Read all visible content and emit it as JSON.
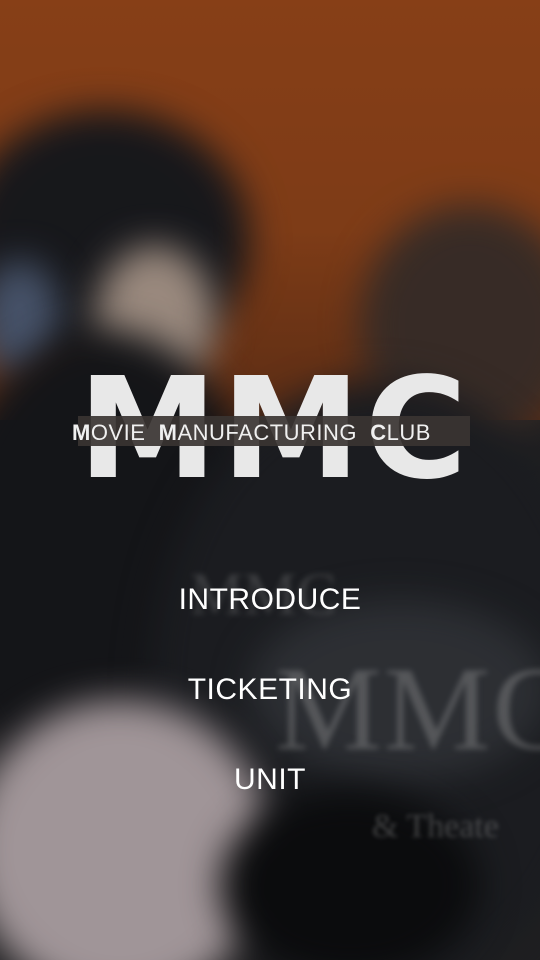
{
  "logo": {
    "monogram": "MMC",
    "subtitle": {
      "w1_initial": "M",
      "w1_rest": "OVIE",
      "w2_initial": "M",
      "w2_rest": "ANUFACTURING",
      "w3_initial": "C",
      "w3_rest": "LUB"
    }
  },
  "background": {
    "printed_text_large": "MMC",
    "printed_text_small": "& Theate"
  },
  "menu": {
    "items": [
      {
        "label": "INTRODUCE"
      },
      {
        "label": "TICKETING"
      },
      {
        "label": "UNIT"
      }
    ]
  },
  "colors": {
    "wall": "#b4541f",
    "logo": "#e8e8e8",
    "menu_text": "#ffffff"
  }
}
